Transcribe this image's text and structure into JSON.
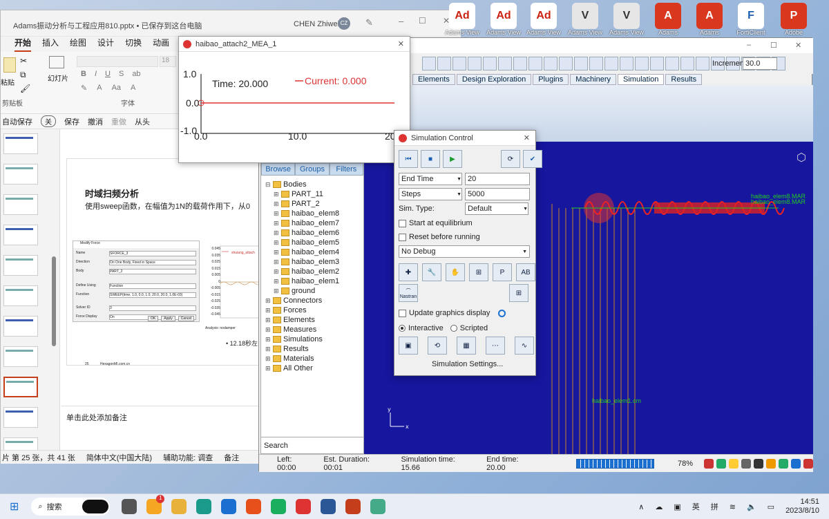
{
  "desktop_icons": [
    {
      "label": "Adams View",
      "kind": "Ad"
    },
    {
      "label": "Adams View",
      "kind": "Ad"
    },
    {
      "label": "Adams View",
      "kind": "Ad"
    },
    {
      "label": "Adams View",
      "kind": "V"
    },
    {
      "label": "Adams View",
      "kind": "V"
    },
    {
      "label": "Adams",
      "kind": "A"
    },
    {
      "label": "Adams",
      "kind": "A"
    },
    {
      "label": "FortiClient",
      "kind": "F"
    },
    {
      "label": "Adobe",
      "kind": "P"
    }
  ],
  "ppt": {
    "title": "Adams振动分析与工程应用810.pptx • 已保存到这台电脑",
    "user": "CHEN Zhiwei",
    "user_initials": "CZ",
    "tabs": [
      "开始",
      "插入",
      "绘图",
      "设计",
      "切换",
      "动画",
      "幻灯片"
    ],
    "active_tab": "开始",
    "clipboard_group": "剪贴板",
    "font_group": "字体",
    "paste_label": "粘贴",
    "slideshow_label": "幻灯片",
    "font_size": "18",
    "qat": {
      "autosave": "自动保存",
      "toggle": "关",
      "save": "保存",
      "undo": "撤消",
      "redo": "重做",
      "from_start": "从头"
    },
    "slide_title": "时域扫频分析",
    "slide_text": "使用sweep函数，在幅值为1N的载荷作用下，从0",
    "dialog_title": "Modify Force",
    "dialog_rows": [
      {
        "label": "Name",
        "value": "SFORCE_3"
      },
      {
        "label": "Direction",
        "value": "On One Body, Fixed in Space"
      },
      {
        "label": "Body",
        "value": "PART_2"
      },
      {
        "label": "Define Using",
        "value": "Function"
      },
      {
        "label": "Function",
        "value": "SWEEP(time, 1.0, 0.0, 1.0, 20.0, 20.0, 1.0E-03)"
      },
      {
        "label": "Solver ID",
        "value": "3"
      },
      {
        "label": "Force Display",
        "value": "On"
      }
    ],
    "dialog_buttons": [
      "OK",
      "Apply",
      "Cancel"
    ],
    "mini_chart_axis": [
      "0.045",
      "0.035",
      "0.025",
      "0.015",
      "0.005",
      "0",
      "-0.005",
      "-0.015",
      "-0.025",
      "-0.035",
      "-0.045"
    ],
    "mini_chart_legend": "shuiang_attach",
    "mini_chart_caption": "Analysis: nodamper",
    "bullet": "12.18秒左",
    "slide_number": "25",
    "slide_footer": "HexagonMI.com.cn",
    "notes": "单击此处添加备注",
    "status": {
      "slide": "片 第 25 张，共 41 张",
      "language": "简体中文(中国大陆)",
      "accessibility": "辅助功能: 调查",
      "notes_btn": "备注"
    }
  },
  "plot": {
    "title": "haibao_attach2_MEA_1",
    "time_label": "Time:  20.000",
    "current_label": "Current:  0.000",
    "y_ticks": [
      "1.0",
      "0.0",
      "-1.0"
    ],
    "x_ticks": [
      "0.0",
      "10.0",
      "20"
    ]
  },
  "adams": {
    "increment_label": "Increment",
    "increment_value": "30.0",
    "tabs": [
      "Elements",
      "Design Exploration",
      "Plugins",
      "Machinery",
      "Simulation",
      "Results"
    ],
    "active_tab": "Simulation",
    "browser_tabs": [
      "Browse",
      "Groups",
      "Filters"
    ],
    "tree": [
      {
        "label": "Bodies",
        "level": 0,
        "open": true
      },
      {
        "label": "PART_11",
        "level": 1
      },
      {
        "label": "PART_2",
        "level": 1
      },
      {
        "label": "haibao_elem8",
        "level": 1
      },
      {
        "label": "haibao_elem7",
        "level": 1
      },
      {
        "label": "haibao_elem6",
        "level": 1
      },
      {
        "label": "haibao_elem5",
        "level": 1
      },
      {
        "label": "haibao_elem4",
        "level": 1
      },
      {
        "label": "haibao_elem3",
        "level": 1
      },
      {
        "label": "haibao_elem2",
        "level": 1
      },
      {
        "label": "haibao_elem1",
        "level": 1
      },
      {
        "label": "ground",
        "level": 1
      },
      {
        "label": "Connectors",
        "level": 0
      },
      {
        "label": "Forces",
        "level": 0
      },
      {
        "label": "Elements",
        "level": 0
      },
      {
        "label": "Measures",
        "level": 0
      },
      {
        "label": "Simulations",
        "level": 0
      },
      {
        "label": "Results",
        "level": 0
      },
      {
        "label": "Materials",
        "level": 0
      },
      {
        "label": "All Other",
        "level": 0
      }
    ],
    "search_label": "Search",
    "status": {
      "left": "Left: 00:00",
      "duration": "Est. Duration: 00:01",
      "sim_time": "Simulation time: 15.66",
      "end_time": "End time: 20.00",
      "zoom": "78%"
    },
    "viewport_labels": [
      "haibao_elem8.MAR",
      "haibao_elem8.MAR",
      "haibao_elem1.cm"
    ]
  },
  "sim": {
    "title": "Simulation Control",
    "end_combo": "End Time",
    "end_value": "20",
    "steps_combo": "Steps",
    "steps_value": "5000",
    "sim_type_label": "Sim. Type:",
    "sim_type_value": "Default",
    "start_equilibrium": "Start at equilibrium",
    "reset_before": "Reset before running",
    "debug": "No Debug",
    "nastran": "Nastran",
    "update_graphics": "Update graphics display",
    "interactive": "Interactive",
    "scripted": "Scripted",
    "settings_btn": "Simulation Settings..."
  },
  "taskbar": {
    "search": "搜索",
    "badge": "1",
    "ime1": "英",
    "ime2": "拼",
    "time": "14:51",
    "date": "2023/8/10"
  }
}
